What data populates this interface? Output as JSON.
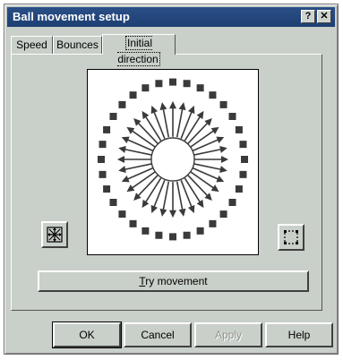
{
  "window": {
    "title": "Ball movement setup",
    "help_glyph": "?",
    "close_glyph": "✕"
  },
  "tabs": [
    {
      "label": "Speed",
      "active": false
    },
    {
      "label": "Bounces",
      "active": false
    },
    {
      "label": "Initial direction",
      "active": true
    }
  ],
  "canvas": {
    "icon": "radial-direction-selector",
    "spokes": 32
  },
  "side_buttons": {
    "left_icon": "all-directions-icon",
    "right_icon": "dotted-square-icon"
  },
  "try_button": {
    "mnemonic": "T",
    "rest": "ry movement"
  },
  "footer": {
    "ok": "OK",
    "cancel": "Cancel",
    "apply": "Apply",
    "help": "Help"
  },
  "colors": {
    "titlebar": "#1d3f73",
    "dialog_bg": "#c9cfc9",
    "spoke": "#3a3a3a"
  }
}
